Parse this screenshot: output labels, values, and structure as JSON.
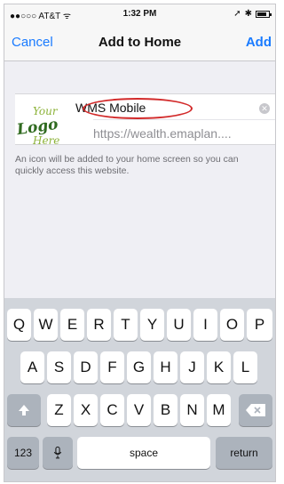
{
  "status_bar": {
    "carrier": "●●○○○ AT&T ᯤ",
    "time": "1:32 PM",
    "right_icons": [
      "location-icon",
      "bluetooth-icon",
      "battery-icon"
    ]
  },
  "nav": {
    "cancel": "Cancel",
    "title": "Add to Home",
    "add": "Add",
    "accent": "#1a7bff"
  },
  "bookmark": {
    "logo_line1": "Your",
    "logo_line2": "Logo",
    "logo_line3": "Here",
    "title_value": "WMS Mobile",
    "url": "https://wealth.emaplan....",
    "highlight_color": "#d22a2a"
  },
  "help_text": "An icon will be added to your home screen so you can quickly access this website.",
  "keyboard": {
    "row1": [
      "Q",
      "W",
      "E",
      "R",
      "T",
      "Y",
      "U",
      "I",
      "O",
      "P"
    ],
    "row2": [
      "A",
      "S",
      "D",
      "F",
      "G",
      "H",
      "J",
      "K",
      "L"
    ],
    "row3": [
      "Z",
      "X",
      "C",
      "V",
      "B",
      "N",
      "M"
    ],
    "numbers_key": "123",
    "space_key": "space",
    "return_key": "return"
  }
}
